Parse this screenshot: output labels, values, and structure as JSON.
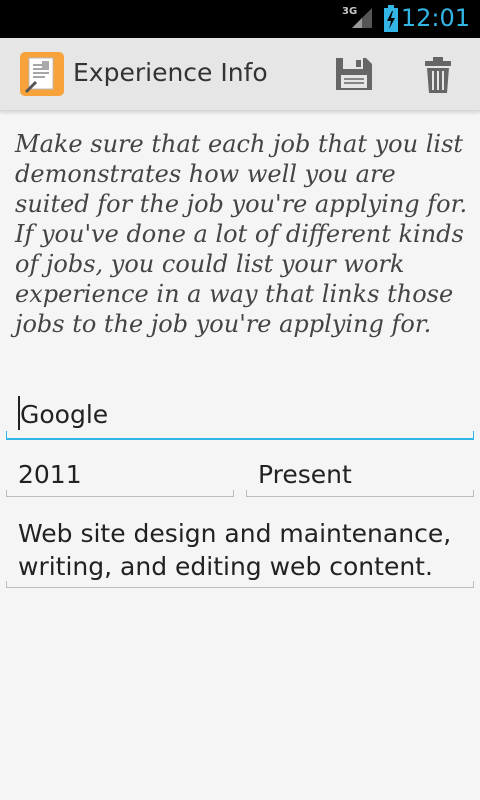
{
  "status_bar": {
    "network": "3G",
    "time": "12:01"
  },
  "action_bar": {
    "title": "Experience Info",
    "icons": [
      "resume-app-icon",
      "save-icon",
      "delete-icon"
    ]
  },
  "guidance_text": "Make sure that each job that you list demonstrates how well you are suited for the job you're applying for. If you've done a lot of different kinds of jobs, you could list your work experience in a way that links those jobs to the job you're applying for.",
  "form": {
    "company": {
      "value": "Google"
    },
    "start_year": {
      "value": "2011"
    },
    "end_year": {
      "value": "Present"
    },
    "description": {
      "value": "Web site design and maintenance, writing, and editing web content."
    }
  },
  "colors": {
    "accent": "#33b5e5",
    "action_bar_bg": "#e6e6e6",
    "background": "#f5f5f5"
  }
}
